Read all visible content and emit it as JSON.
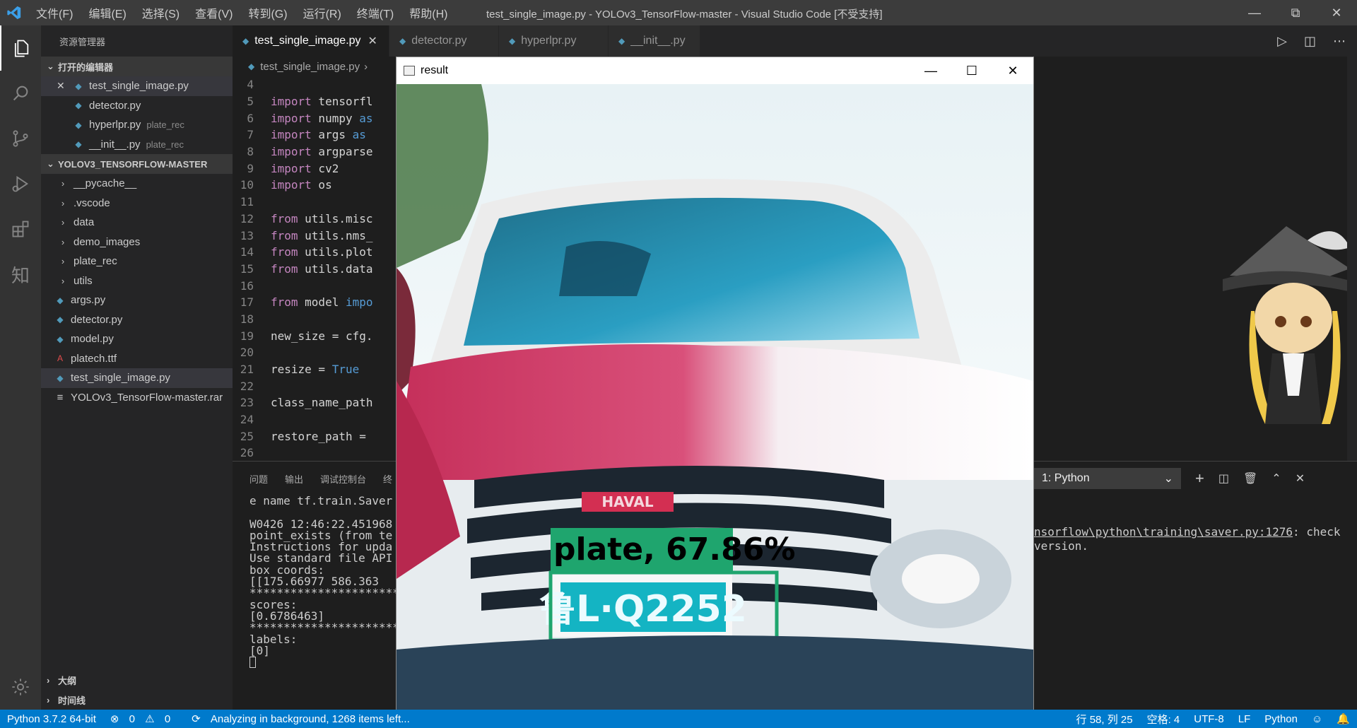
{
  "titlebar": {
    "menus": [
      "文件(F)",
      "编辑(E)",
      "选择(S)",
      "查看(V)",
      "转到(G)",
      "运行(R)",
      "终端(T)",
      "帮助(H)"
    ],
    "title": "test_single_image.py - YOLOv3_TensorFlow-master - Visual Studio Code [不受支持]"
  },
  "sidebar": {
    "title": "资源管理器",
    "open_editors_label": "打开的编辑器",
    "open_editors": [
      {
        "name": "test_single_image.py",
        "desc": ""
      },
      {
        "name": "detector.py",
        "desc": ""
      },
      {
        "name": "hyperlpr.py",
        "desc": "plate_rec"
      },
      {
        "name": "__init__.py",
        "desc": "plate_rec"
      }
    ],
    "project_label": "YOLOV3_TENSORFLOW-MASTER",
    "folders": [
      "__pycache__",
      ".vscode",
      "data",
      "demo_images",
      "plate_rec",
      "utils"
    ],
    "files": [
      "args.py",
      "detector.py",
      "model.py",
      "platech.ttf",
      "test_single_image.py",
      "YOLOv3_TensorFlow-master.rar"
    ],
    "outline_label": "大纲",
    "timeline_label": "时间线"
  },
  "tabs": [
    "test_single_image.py",
    "detector.py",
    "hyperlpr.py",
    "__init__.py"
  ],
  "breadcrumb": "test_single_image.py",
  "code": [
    {
      "n": "4",
      "a": "",
      "b": ""
    },
    {
      "n": "5",
      "a": "import",
      "b": " tensorfl",
      "c": ""
    },
    {
      "n": "6",
      "a": "import",
      "b": " numpy ",
      "c": "as"
    },
    {
      "n": "7",
      "a": "import",
      "b": " args ",
      "c": "as"
    },
    {
      "n": "8",
      "a": "import",
      "b": " argparse",
      "c": ""
    },
    {
      "n": "9",
      "a": "import",
      "b": " cv2",
      "c": ""
    },
    {
      "n": "10",
      "a": "import",
      "b": " os",
      "c": ""
    },
    {
      "n": "11",
      "a": "",
      "b": ""
    },
    {
      "n": "12",
      "a": "from",
      "b": " utils.misc",
      "c": ""
    },
    {
      "n": "13",
      "a": "from",
      "b": " utils.nms_",
      "c": ""
    },
    {
      "n": "14",
      "a": "from",
      "b": " utils.plot",
      "c": ""
    },
    {
      "n": "15",
      "a": "from",
      "b": " utils.data",
      "c": ""
    },
    {
      "n": "16",
      "a": "",
      "b": ""
    },
    {
      "n": "17",
      "a": "from",
      "b": " model ",
      "c": "impo"
    },
    {
      "n": "18",
      "a": "",
      "b": ""
    },
    {
      "n": "19",
      "a": "",
      "b": "new_size = cfg.",
      "c": ""
    },
    {
      "n": "20",
      "a": "",
      "b": ""
    },
    {
      "n": "21",
      "a": "",
      "b": "resize = ",
      "c": "True"
    },
    {
      "n": "22",
      "a": "",
      "b": ""
    },
    {
      "n": "23",
      "a": "",
      "b": "class_name_path",
      "c": ""
    },
    {
      "n": "24",
      "a": "",
      "b": ""
    },
    {
      "n": "25",
      "a": "",
      "b": "restore_path = ",
      "c": ""
    },
    {
      "n": "26",
      "a": "",
      "b": ""
    }
  ],
  "panel": {
    "tabs": [
      "问题",
      "输出",
      "调试控制台",
      "终"
    ],
    "terminal_select": "1: Python",
    "terminal_lines": [
      "e name tf.train.Saver",
      "",
      "W0426 12:46:22.451968",
      "point_exists (from te",
      "Instructions for upda",
      "Use standard file API",
      "box coords:",
      "[[175.66977 586.363 ",
      "************************",
      "scores:",
      "[0.6786463]",
      "************************",
      "labels:",
      "[0]"
    ],
    "terminal_right_link": "nsorflow\\python\\training\\saver.py:1276",
    "terminal_right_rest": ": check",
    "terminal_right_line2": "version."
  },
  "result_window": {
    "title": "result",
    "detection_label": "plate, 67.86%",
    "plate_text": "鲁L·Q2252",
    "grille_badge": "HAVAL"
  },
  "statusbar": {
    "python": "Python 3.7.2 64-bit",
    "errors": "0",
    "warnings": "0",
    "analyzing": "Analyzing in background, 1268 items left...",
    "position": "行 58, 列 25",
    "spaces": "空格: 4",
    "encoding": "UTF-8",
    "eol": "LF",
    "language": "Python"
  },
  "colors": {
    "statusbar": "#007acc",
    "titlebar": "#3c3c3c",
    "sidebar": "#252526",
    "editor": "#1e1e1e",
    "detection_box": "#1fa56e"
  }
}
